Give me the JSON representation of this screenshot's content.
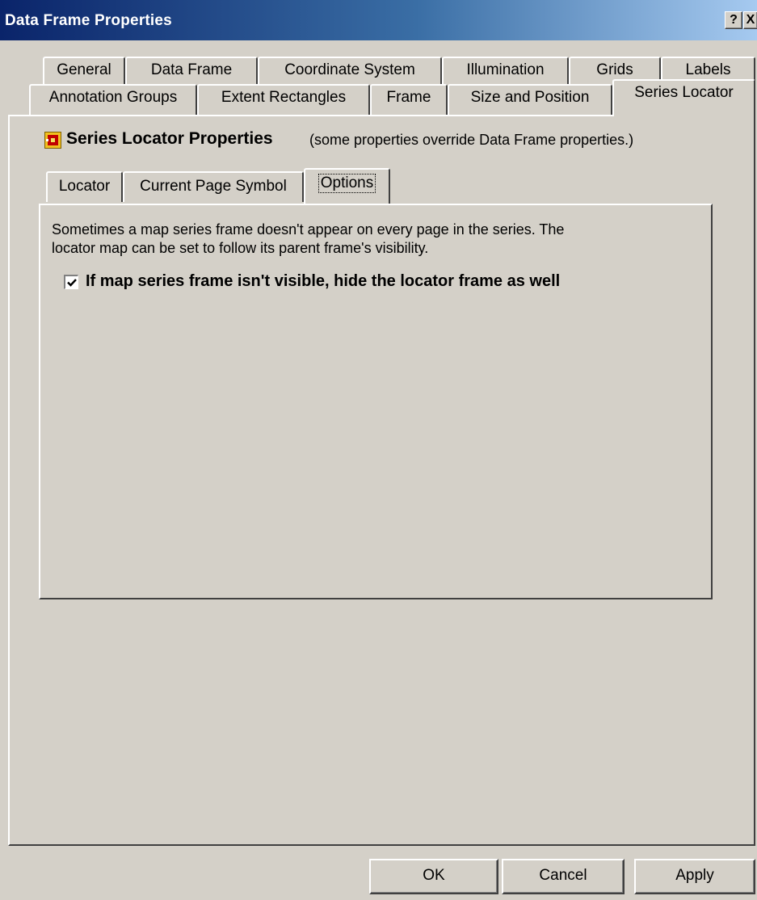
{
  "window": {
    "title": "Data Frame Properties",
    "help_glyph": "?",
    "close_glyph": "X"
  },
  "tabs": {
    "row_back": [
      "General",
      "Data Frame",
      "Coordinate System",
      "Illumination",
      "Grids",
      "Labels"
    ],
    "row_front": [
      "Annotation Groups",
      "Extent Rectangles",
      "Frame",
      "Size and Position",
      "Series Locator"
    ],
    "selected": "Series Locator"
  },
  "panel": {
    "title": "Series Locator Properties",
    "note": "(some properties override Data Frame properties.)",
    "icon": "series-locator-icon"
  },
  "inner_tabs": {
    "items": [
      "Locator",
      "Current Page Symbol",
      "Options"
    ],
    "selected": "Options"
  },
  "options": {
    "description_line1": "Sometimes a map series frame doesn't appear on every page in the series.  The",
    "description_line2": "locator map can be set to follow its parent frame's visibility.",
    "checkbox_label": "If map series frame isn't visible, hide the locator frame as well",
    "checkbox_checked": true
  },
  "buttons": {
    "ok": "OK",
    "cancel": "Cancel",
    "apply": "Apply"
  }
}
